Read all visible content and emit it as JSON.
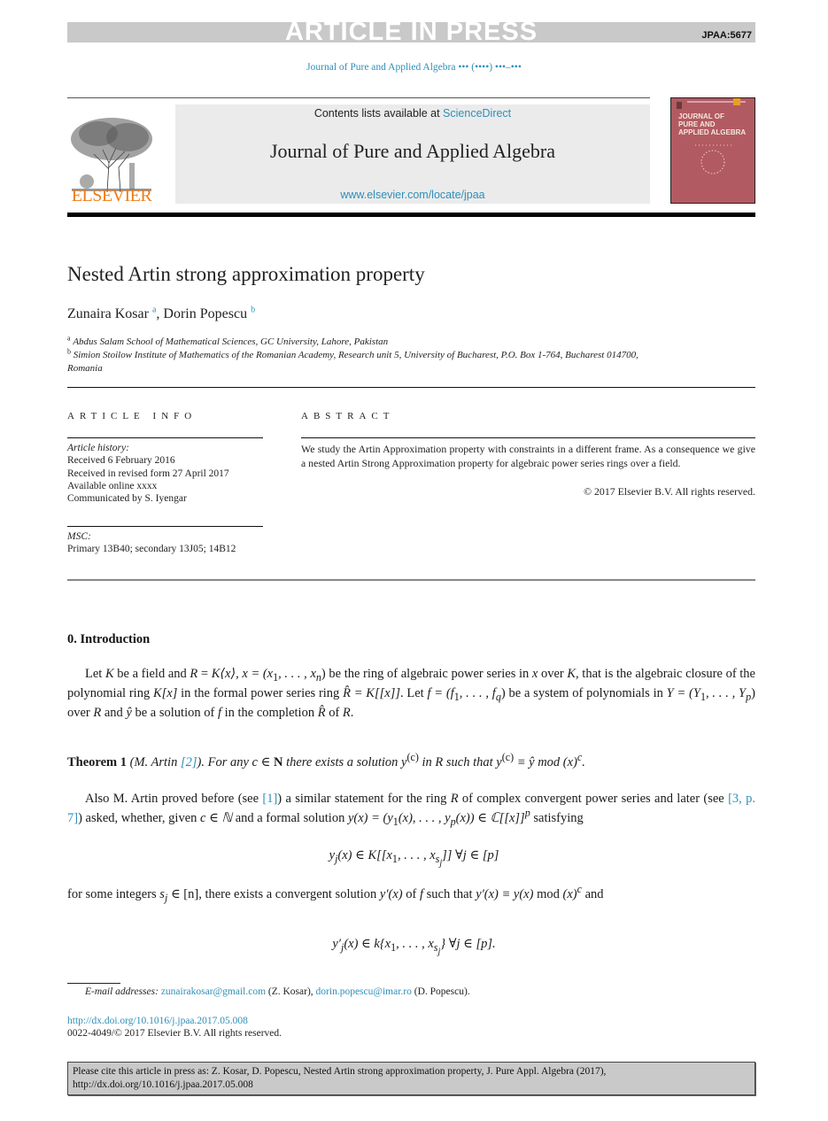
{
  "banner": {
    "title": "ARTICLE IN PRESS",
    "article_id": "JPAA:5677"
  },
  "running_head": "Journal of Pure and Applied Algebra ••• (••••) •••–•••",
  "masthead": {
    "publisher_logo_text": "ELSEVIER",
    "contents_prefix": "Contents lists available at ",
    "contents_link": "ScienceDirect",
    "journal_title": "Journal of Pure and Applied Algebra",
    "journal_url": "www.elsevier.com/locate/jpaa",
    "cover_title_lines": [
      "JOURNAL OF",
      "PURE AND",
      "APPLIED ALGEBRA"
    ],
    "colors": {
      "publisher_orange": "#f07b16",
      "link_blue": "#2f8fb8",
      "cover_red": "#b25a61"
    }
  },
  "article": {
    "title": "Nested Artin strong approximation property",
    "authors": [
      {
        "name": "Zunaira Kosar",
        "affil_mark": "a"
      },
      {
        "name": "Dorin Popescu",
        "affil_mark": "b"
      }
    ],
    "author_separator": ", ",
    "affiliations": [
      {
        "mark": "a",
        "text": "Abdus Salam School of Mathematical Sciences, GC University, Lahore, Pakistan"
      },
      {
        "mark": "b",
        "text": "Simion Stoilow Institute of Mathematics of the Romanian Academy, Research unit 5, University of Bucharest, P.O. Box 1-764, Bucharest 014700, Romania"
      }
    ]
  },
  "article_info": {
    "heading": "ARTICLE INFO",
    "history_label": "Article history:",
    "history": [
      "Received 6 February 2016",
      "Received in revised form 27 April 2017",
      "Available online xxxx",
      "Communicated by S. Iyengar"
    ],
    "msc_label": "MSC:",
    "msc": "Primary 13B40; secondary 13J05; 14B12"
  },
  "abstract": {
    "heading": "ABSTRACT",
    "text": "We study the Artin Approximation property with constraints in a different frame. As a consequence we give a nested Artin Strong Approximation property for algebraic power series rings over a field.",
    "copyright": "© 2017 Elsevier B.V. All rights reserved."
  },
  "body": {
    "section_heading": "0. Introduction",
    "intro": {
      "t1": "Let ",
      "K": "K",
      "t2": " be a field and ",
      "R": "R",
      "eq": " = ",
      "Kx": "K⟨x⟩, x = (x",
      "s1": "1",
      "t3": ", . . . , x",
      "sn": "n",
      "t4": ") be the ring of algebraic power series in ",
      "x": "x",
      "t5": " over ",
      "K2": "K",
      "t6": ", that is the algebraic closure of the polynomial ring ",
      "Kpoly": "K[x]",
      "t7": " in the formal power series ring ",
      "Rhat": "R̂ = K[[x]]",
      "t8": ". Let ",
      "f": "f = (f",
      "f1": "1",
      "t9": ", . . . , f",
      "fq": "q",
      "t10": ") be a system of polynomials in ",
      "Y": "Y = (Y",
      "Y1": "1",
      "t11": ", . . . , Y",
      "Yp": "p",
      "t12": ") over ",
      "R2": "R",
      "t13": " and ",
      "yhat": "ŷ",
      "t14": " be a solution of ",
      "f2": "f",
      "t15": " in the completion ",
      "Rhat2": "R̂",
      "t16": " of ",
      "R3": "R",
      "t17": "."
    },
    "theorem": {
      "label": "Theorem 1",
      "attribution_prefix": " (M. Artin ",
      "ref": "[2]",
      "attribution_suffix": "). ",
      "s1": "For any c ∈ ",
      "N": "N",
      "s2": " there exists a solution y",
      "sup1": "(c)",
      "s3": " in R such that y",
      "sup2": "(c)",
      "s4": " ≡ ŷ mod (x)",
      "sup3": "c",
      "s5": "."
    },
    "also": {
      "t1": "Also M. Artin proved before (see ",
      "ref1": "[1]",
      "t2": ") a similar statement for the ring ",
      "R": "R",
      "t3": " of complex convergent power series and later (see ",
      "ref2": "[3, p. 7]",
      "t4": ") asked, whether, given ",
      "c": "c ∈ ℕ",
      "t5": " and a formal solution ",
      "y": "y(x) = (y",
      "y1": "1",
      "t6": "(x), . . . , y",
      "yp": "p",
      "t7": "(x)) ∈ ℂ[[x]]",
      "supp": "p",
      "t8": " satisfying"
    },
    "eq1": {
      "a": "y",
      "aj": "j",
      "b": "(x) ∈ K[[x",
      "b1": "1",
      "c": ", . . . , x",
      "cs": "s",
      "csj": "j",
      "d": "]]   ∀j ∈ [p]"
    },
    "forsome": {
      "t1": "for some integers ",
      "s": "s",
      "sj": "j",
      "t2": " ∈ [n], there exists a convergent solution ",
      "y1": "y′(x)",
      "t3": " of ",
      "f": "f",
      "t4": " such that ",
      "y2": "y′(x) ≡ y(x)",
      "t5": " mod ",
      "x": "(x)",
      "supc": "c",
      "t6": " and"
    },
    "eq2": {
      "a": "y′",
      "aj": "j",
      "b": "(x) ∈ k{x",
      "b1": "1",
      "c": ", . . . , x",
      "cs": "s",
      "csj": "j",
      "d": "}   ∀j ∈ [p]."
    }
  },
  "footnotes": {
    "emails_label": "E-mail addresses:",
    "email_1": "zunairakosar@gmail.com",
    "email_1_owner": " (Z. Kosar), ",
    "email_2": "dorin.popescu@imar.ro",
    "email_2_owner": " (D. Popescu).",
    "doi": "http://dx.doi.org/10.1016/j.jpaa.2017.05.008",
    "issn": "0022-4049/© 2017 Elsevier B.V. All rights reserved."
  },
  "cite_box": "Please cite this article in press as: Z. Kosar, D. Popescu, Nested Artin strong approximation property, J. Pure Appl. Algebra (2017), http://dx.doi.org/10.1016/j.jpaa.2017.05.008"
}
